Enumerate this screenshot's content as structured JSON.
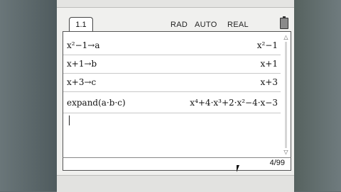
{
  "tab": {
    "label": "1.1"
  },
  "status": {
    "angle": "RAD",
    "mode": "AUTO",
    "real": "REAL"
  },
  "history": [
    {
      "input": "x²−1→a",
      "output": "x²−1"
    },
    {
      "input": "x+1→b",
      "output": "x+1"
    },
    {
      "input": "x+3→c",
      "output": "x+3"
    },
    {
      "input": "expand(a·b·c)",
      "output": "x⁴+4·x³+2·x²−4·x−3"
    }
  ],
  "statusbar": {
    "page": "4/99"
  },
  "icons": {
    "battery": "battery-icon",
    "scroll_up": "scroll-up-arrow-icon",
    "scroll_down": "scroll-down-arrow-icon",
    "pointer": "mouse-pointer-icon"
  },
  "colors": {
    "bezel": "#5f6b6e",
    "screen": "#f0f0ee",
    "document": "#ffffff"
  }
}
